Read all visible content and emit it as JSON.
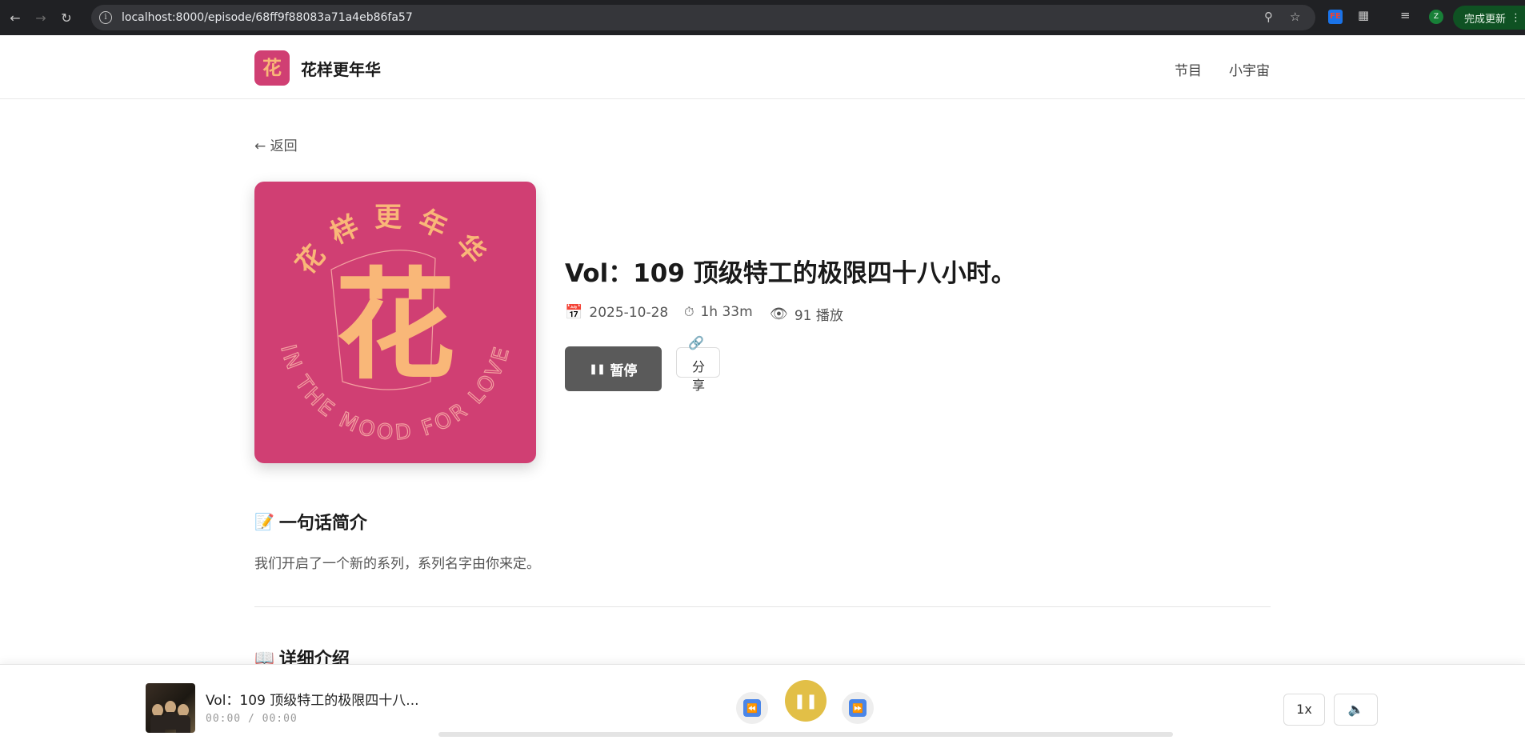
{
  "browser": {
    "url": "localhost:8000/episode/68ff9f88083a71a4eb86fa57",
    "update_label": "完成更新",
    "profile_initial": "Z",
    "ext_fe": "FE"
  },
  "header": {
    "logo_char": "花",
    "brand": "花样更年华",
    "nav": [
      "节目",
      "小宇宙"
    ]
  },
  "main": {
    "back_label": "← 返回",
    "cover": {
      "center_char": "花",
      "arc_top": "花样更年华",
      "arc_bottom": "IN THE MOOD FOR LOVE",
      "bg_color": "#d03f73",
      "fg_color": "#f9b778"
    },
    "episode_title": "Vol：109 顶级特工的极限四十八小时。",
    "meta": {
      "date_icon": "calendar-icon",
      "date": "2025-10-28",
      "duration_icon": "stopwatch-icon",
      "duration": "1h 33m",
      "plays_icon": "eye-icon",
      "plays": "91 播放"
    },
    "pause_label": "暂停",
    "share_label_1": "分",
    "share_label_2": "享",
    "summary_title": "一句话简介",
    "summary_text": "我们开启了一个新的系列，系列名字由你来定。",
    "detail_title": "详细介绍"
  },
  "player": {
    "title": "Vol：109 顶级特工的极限四十八...",
    "time": "00:00 / 00:00",
    "speed": "1x",
    "progress": 0,
    "accent": "#e2bf47"
  }
}
